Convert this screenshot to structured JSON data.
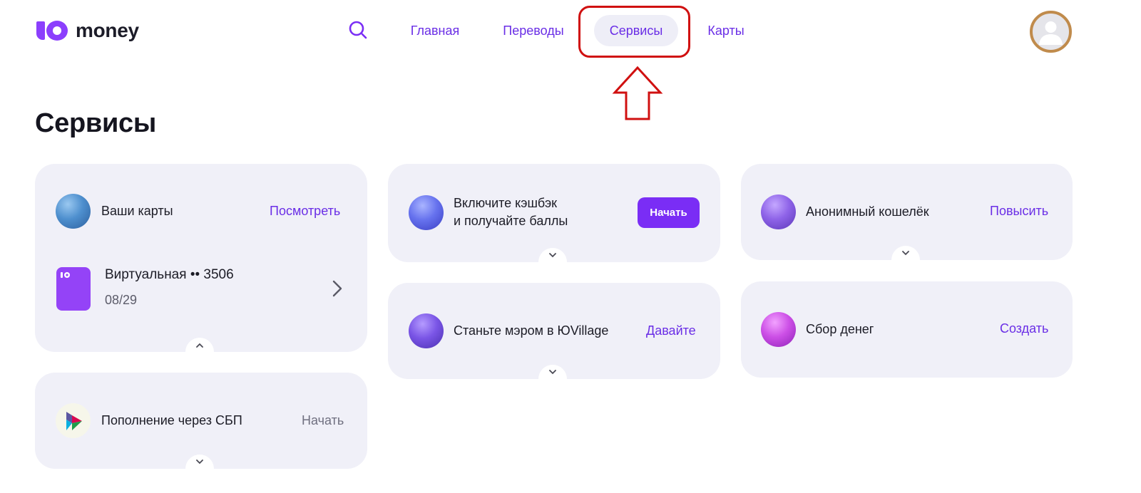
{
  "header": {
    "logo_text": "money",
    "nav": [
      {
        "label": "Главная"
      },
      {
        "label": "Переводы"
      },
      {
        "label": "Сервисы",
        "active": true
      },
      {
        "label": "Карты"
      }
    ]
  },
  "page_title": "Сервисы",
  "cards": {
    "your_cards": {
      "title": "Ваши карты",
      "action": "Посмотреть",
      "card_name": "Виртуальная •• 3506",
      "card_expiry": "08/29"
    },
    "cashback": {
      "title_line1": "Включите кэшбэк",
      "title_line2": "и получайте баллы",
      "action": "Начать"
    },
    "anonymous_wallet": {
      "title": "Анонимный кошелёк",
      "action": "Повысить"
    },
    "mayor": {
      "title": "Станьте мэром в ЮVillage",
      "action": "Давайте"
    },
    "fundraising": {
      "title": "Сбор денег",
      "action": "Создать"
    },
    "sbp_topup": {
      "title": "Пополнение через СБП",
      "action": "Начать"
    }
  },
  "colors": {
    "accent": "#7a2df5",
    "link": "#6a2ee6",
    "card_bg": "#f0f0f8",
    "annotation": "#d01010"
  }
}
